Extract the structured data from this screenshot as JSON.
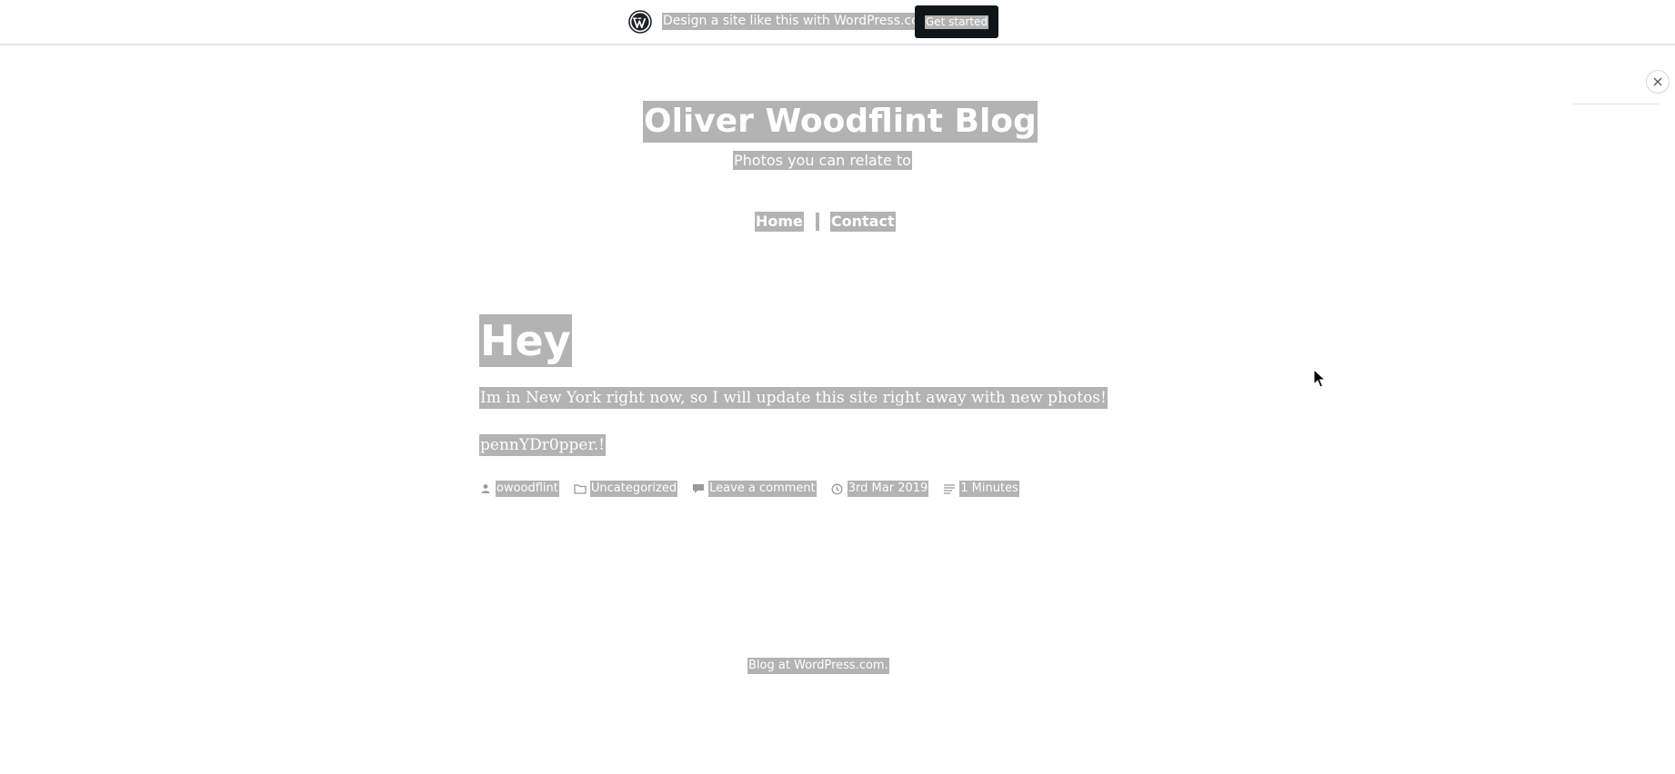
{
  "banner": {
    "promo_text": "Design a site like this with WordPress.com",
    "cta_label": "Get started",
    "logo_icon": "wordpress-logo-icon"
  },
  "widget": {
    "close_icon": "close-icon"
  },
  "site": {
    "title": "Oliver Woodflint Blog",
    "tagline": "Photos you can relate to"
  },
  "nav": {
    "items": [
      {
        "label": "Home"
      },
      {
        "label": "Contact"
      }
    ]
  },
  "post": {
    "title": "Hey",
    "paragraphs": [
      "Im in New York right now, so I will update this site right away with new photos!",
      "pennYDr0pper.!"
    ],
    "meta": {
      "author": "owoodflint",
      "category": "Uncategorized",
      "comments": "Leave a comment",
      "date": "3rd Mar 2019",
      "read_time": "1 Minutes"
    }
  },
  "footer": {
    "text": "Blog at WordPress.com."
  },
  "colors": {
    "selection_bg": "#b3b3b3",
    "cta_bg": "#101517",
    "text": "#ffffff"
  }
}
